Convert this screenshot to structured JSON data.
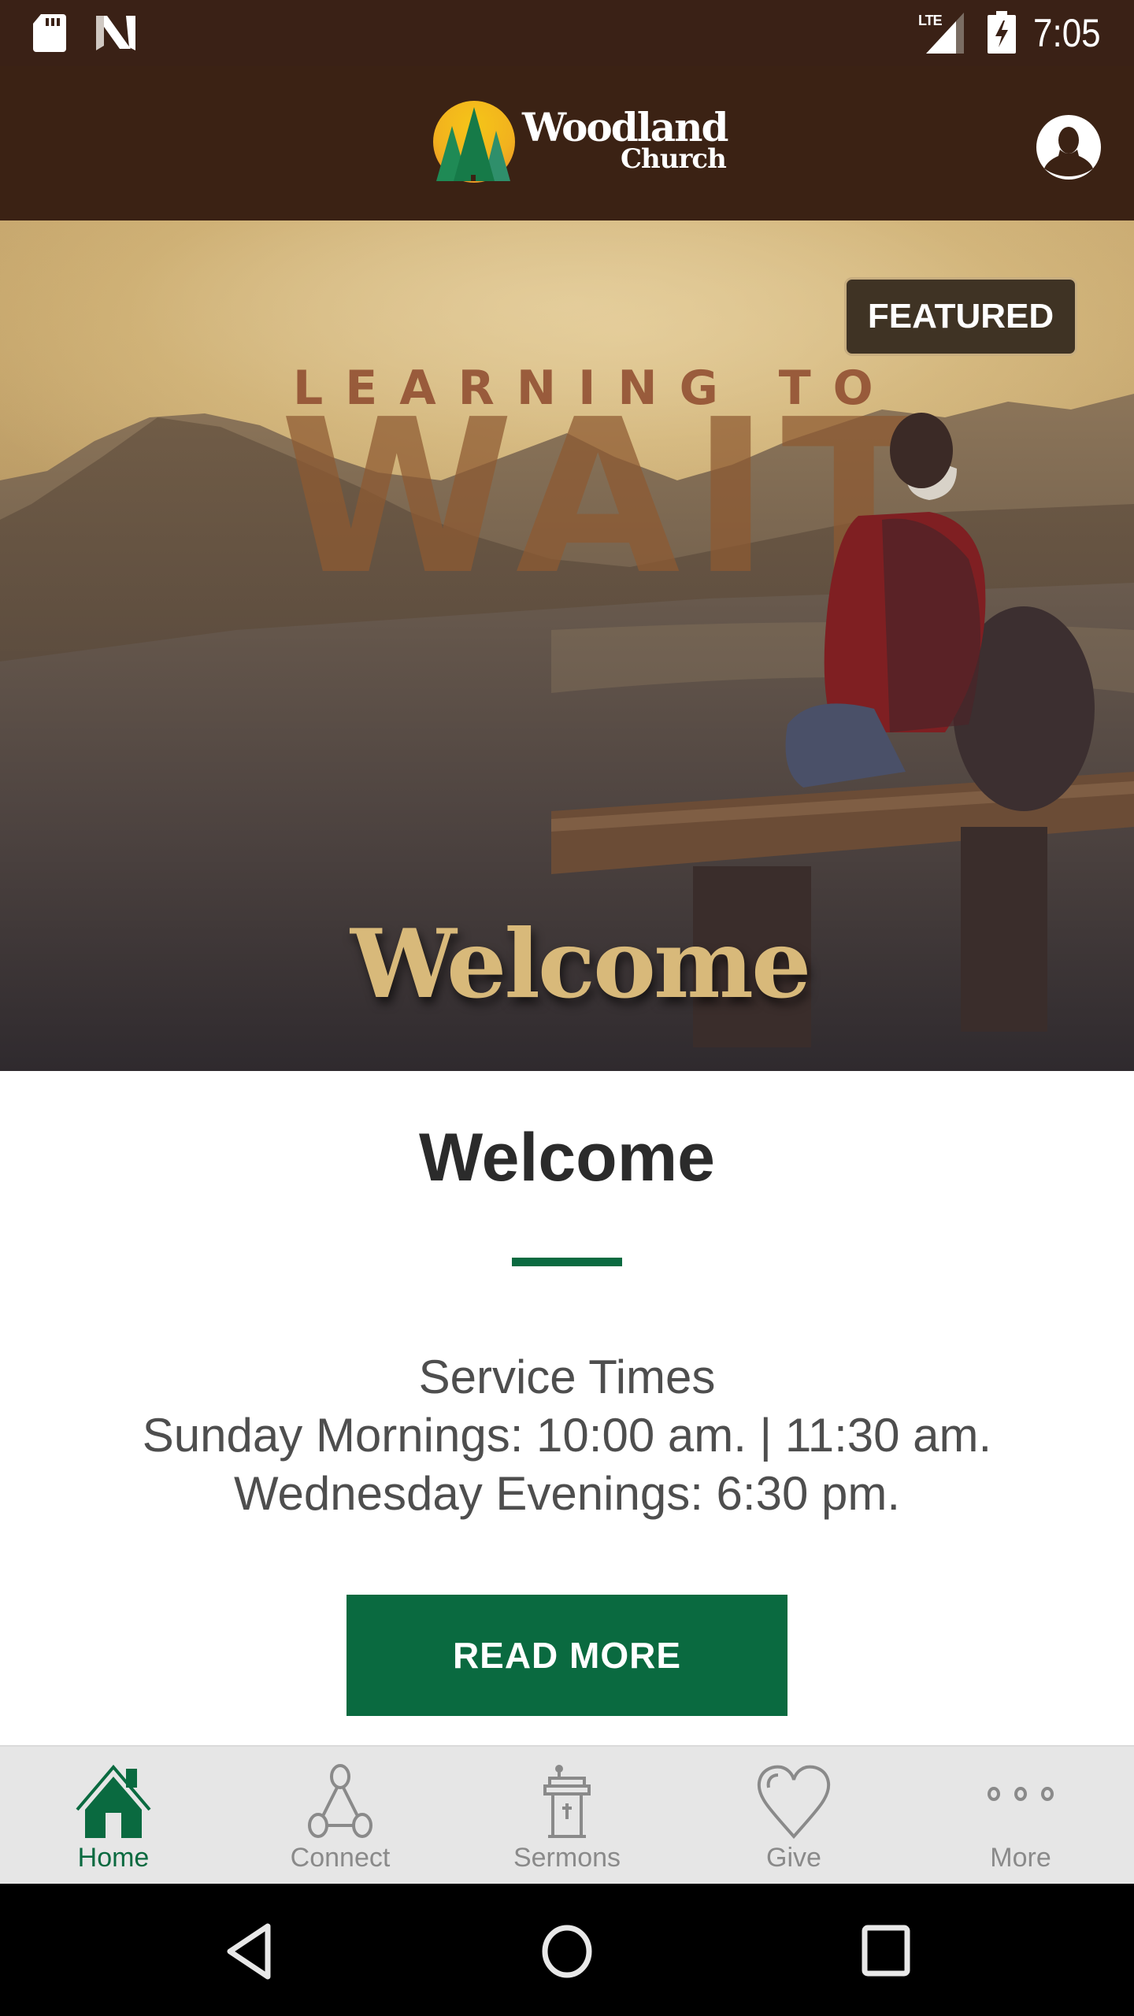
{
  "status_bar": {
    "time": "7:05",
    "network": "LTE",
    "icons": [
      "sd-card-icon",
      "n-notification-icon",
      "signal-icon",
      "battery-charging-icon"
    ]
  },
  "header": {
    "logo_line1": "Woodland",
    "logo_line2": "Church",
    "profile_icon": "profile-icon"
  },
  "hero": {
    "badge": "FEATURED",
    "series_kicker": "LEARNING TO",
    "series_title": "WAIT",
    "image_caption": "Welcome"
  },
  "content": {
    "title": "Welcome",
    "service_lines": [
      "Service Times",
      "Sunday Mornings: 10:00 am. | 11:30 am.",
      "Wednesday Evenings: 6:30 pm."
    ],
    "button_label": "READ MORE"
  },
  "colors": {
    "brand_green": "#0a6a40",
    "header_brown": "#3b2214",
    "tab_inactive": "#8a8a8a"
  },
  "tabs": [
    {
      "label": "Home",
      "icon": "home-icon",
      "active": true
    },
    {
      "label": "Connect",
      "icon": "connect-icon",
      "active": false
    },
    {
      "label": "Sermons",
      "icon": "podium-icon",
      "active": false
    },
    {
      "label": "Give",
      "icon": "heart-icon",
      "active": false
    },
    {
      "label": "More",
      "icon": "more-dots-icon",
      "active": false
    }
  ],
  "system_nav": [
    "back",
    "home",
    "recents"
  ]
}
